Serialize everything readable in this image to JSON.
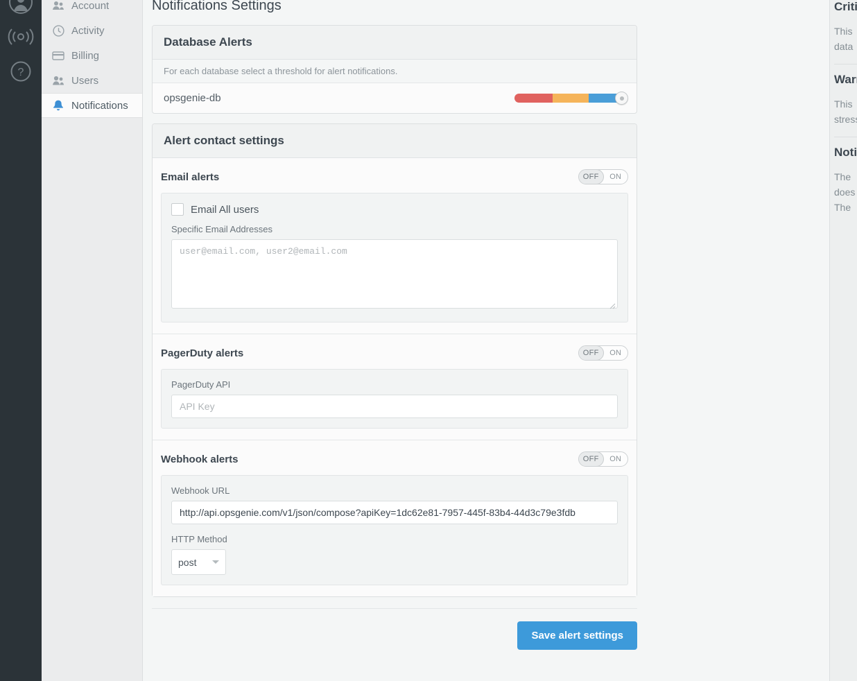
{
  "icon_rail": [
    {
      "name": "user-avatar-icon",
      "label": "Account avatar"
    },
    {
      "name": "broadcast-icon",
      "label": "Status"
    },
    {
      "name": "help-icon",
      "label": "Help"
    }
  ],
  "sidebar": {
    "items": [
      {
        "label": "Account",
        "icon": "people-icon",
        "active": false
      },
      {
        "label": "Activity",
        "icon": "clock-icon",
        "active": false
      },
      {
        "label": "Billing",
        "icon": "credit-card-icon",
        "active": false
      },
      {
        "label": "Users",
        "icon": "users-icon",
        "active": false
      },
      {
        "label": "Notifications",
        "icon": "bell-icon",
        "active": true
      }
    ]
  },
  "page": {
    "title": "Notifications Settings"
  },
  "database_alerts": {
    "heading": "Database Alerts",
    "description": "For each database select a threshold for alert notifications.",
    "rows": [
      {
        "name": "opsgenie-db",
        "threshold": {
          "segments": [
            {
              "label": "critical",
              "color": "#e0625f"
            },
            {
              "label": "warning",
              "color": "#f5b45a"
            },
            {
              "label": "notice",
              "color": "#4a9ed8"
            }
          ],
          "handle_position": "100%"
        }
      }
    ]
  },
  "alert_contact": {
    "heading": "Alert contact settings",
    "toggle_options": {
      "off": "OFF",
      "on": "ON"
    },
    "email": {
      "title": "Email alerts",
      "state": "OFF",
      "all_users_label": "Email All users",
      "all_users_checked": false,
      "specific_label": "Specific Email Addresses",
      "textarea_value": "",
      "textarea_placeholder": "user@email.com, user2@email.com"
    },
    "pagerduty": {
      "title": "PagerDuty alerts",
      "state": "OFF",
      "api_label": "PagerDuty API",
      "api_value": "",
      "api_placeholder": "API Key"
    },
    "webhook": {
      "title": "Webhook alerts",
      "state": "OFF",
      "url_label": "Webhook URL",
      "url_value": "http://api.opsgenie.com/v1/json/compose?apiKey=1dc62e81-7957-445f-83b4-44d3c79e3fdb",
      "method_label": "HTTP Method",
      "method_value": "post"
    }
  },
  "footer": {
    "save_label": "Save alert settings"
  },
  "help_panel": {
    "blocks": [
      {
        "heading": "Critical",
        "lines": [
          "This",
          "data"
        ]
      },
      {
        "heading": "Warning",
        "lines": [
          "This",
          "stress"
        ]
      },
      {
        "heading": "Notice",
        "lines": [
          "The",
          "does",
          "The"
        ]
      }
    ]
  },
  "colors": {
    "accent": "#3d9ada",
    "critical": "#e0625f",
    "warning": "#f5b45a",
    "notice": "#4a9ed8",
    "rail_bg": "#2b3338"
  }
}
